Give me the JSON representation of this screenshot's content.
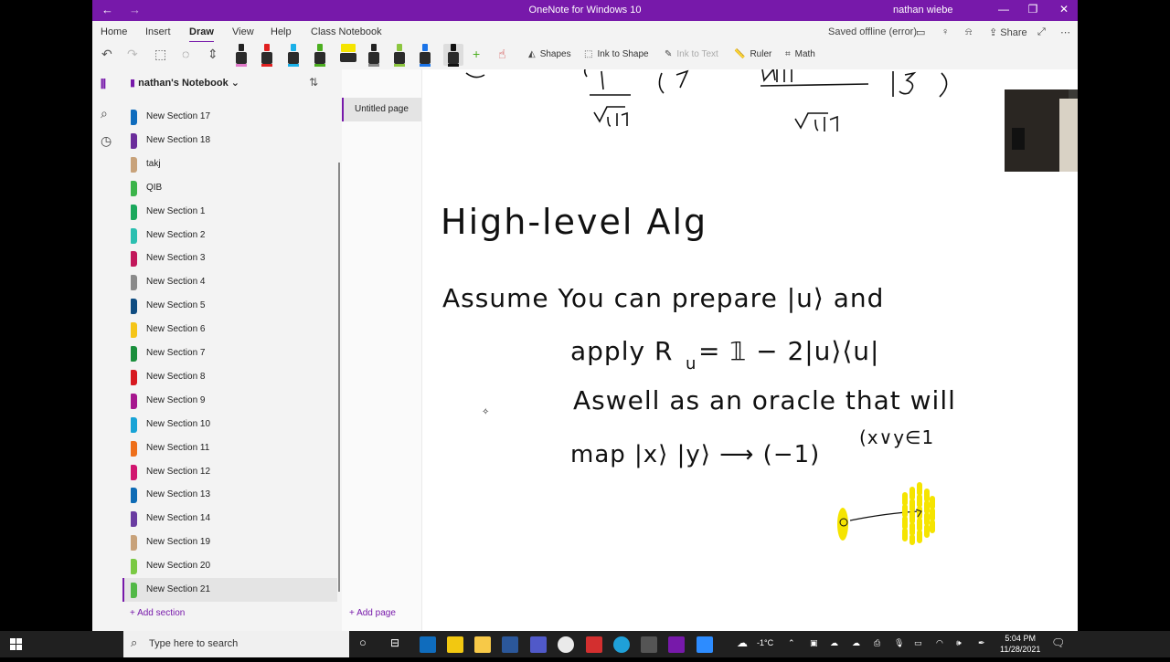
{
  "titlebar": {
    "title": "OneNote for Windows 10",
    "user": "nathan wiebe",
    "back": "←",
    "forward": "→",
    "minimize": "—",
    "restore": "❐",
    "close": "✕"
  },
  "menu": {
    "home": "Home",
    "insert": "Insert",
    "draw": "Draw",
    "view": "View",
    "help": "Help",
    "class_notebook": "Class Notebook",
    "saved": "Saved offline (error)",
    "share": "Share"
  },
  "ribbon": {
    "shapes": "Shapes",
    "ink_to_shape": "Ink to Shape",
    "ink_to_text": "Ink to Text",
    "ruler": "Ruler",
    "math": "Math"
  },
  "notebook": {
    "name": "nathan's Notebook"
  },
  "sections": [
    {
      "label": "New Section 17",
      "color": "#0f6cbd"
    },
    {
      "label": "New Section 18",
      "color": "#6b2d9b"
    },
    {
      "label": "takj",
      "color": "#c8a27a"
    },
    {
      "label": "QIB",
      "color": "#3bb44a"
    },
    {
      "label": "New Section 1",
      "color": "#1aa85c"
    },
    {
      "label": "New Section 2",
      "color": "#2bbfb0"
    },
    {
      "label": "New Section 3",
      "color": "#c2185b"
    },
    {
      "label": "New Section 4",
      "color": "#8a8a8a"
    },
    {
      "label": "New Section 5",
      "color": "#0f4c81"
    },
    {
      "label": "New Section 6",
      "color": "#f5c518"
    },
    {
      "label": "New Section 7",
      "color": "#1a8f3c"
    },
    {
      "label": "New Section 8",
      "color": "#d71920"
    },
    {
      "label": "New Section 9",
      "color": "#a6168e"
    },
    {
      "label": "New Section 10",
      "color": "#18a3d6"
    },
    {
      "label": "New Section 11",
      "color": "#ee6f1a"
    },
    {
      "label": "New Section 12",
      "color": "#d1166f"
    },
    {
      "label": "New Section 13",
      "color": "#0e6bb5"
    },
    {
      "label": "New Section 14",
      "color": "#6a3ca1"
    },
    {
      "label": "New Section 19",
      "color": "#c8a27a"
    },
    {
      "label": "New Section 20",
      "color": "#7ac943"
    },
    {
      "label": "New Section 21",
      "color": "#52b847"
    }
  ],
  "add_section": "Add section",
  "page": {
    "title": "Untitled page"
  },
  "add_page": "Add page",
  "ink": {
    "heading": "High-level Alg",
    "line1": "Assume   You can   prepare   |u⟩  and",
    "line2": "apply   R",
    "line2b": "u",
    "line2c": "  =  𝟙 − 2|u⟩⟨u|",
    "line3": "Aswell  as    an oracle   that will",
    "line4": "map    |x⟩ |y⟩  ⟶  (−1)",
    "line4sup": "(x∨y∈1"
  },
  "taskbar": {
    "search_placeholder": "Type here to search",
    "weather": "-1°C",
    "time": "5:04 PM",
    "date": "11/28/2021"
  }
}
